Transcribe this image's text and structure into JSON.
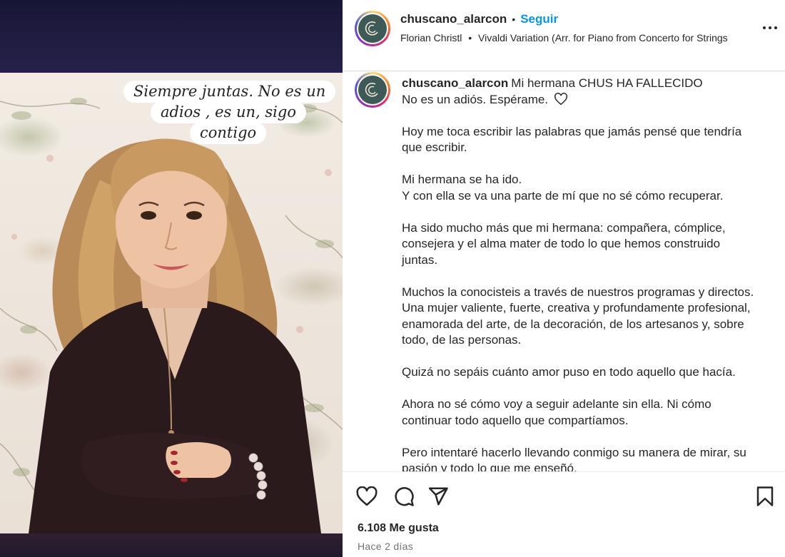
{
  "post": {
    "username": "chuscano_alarcon",
    "follow_label": "Seguir",
    "separator": "•",
    "audio": {
      "artist": "Florian Christl",
      "separator": "•",
      "track": "Vivaldi Variation (Arr. for Piano from Concerto for Strings"
    },
    "media": {
      "overlay_lines": [
        "Siempre juntas. No es un",
        "adios , es un, sigo",
        "contigo"
      ]
    },
    "caption": {
      "username": "chuscano_alarcon",
      "paragraphs": [
        [
          "Mi hermana CHUS HA FALLECIDO",
          "No es un adiós. Espérame."
        ],
        [
          "Hoy me toca escribir las palabras que jamás pensé que tendría",
          "que escribir."
        ],
        [
          "Mi hermana se ha ido.",
          "Y con ella se va una parte de mí que no sé cómo recuperar."
        ],
        [
          "Ha sido mucho más que mi hermana: compañera, cómplice,",
          "consejera y el alma mater de todo lo que hemos construido",
          "juntas."
        ],
        [
          "Muchos la conocisteis a través de nuestros programas y directos.",
          "Una mujer valiente, fuerte, creativa y profundamente profesional,",
          "enamorada del arte, de la decoración, de los artesanos y, sobre",
          "todo, de las personas."
        ],
        [
          "Quizá no sepáis cuánto amor puso en todo aquello que hacía."
        ],
        [
          "Ahora no sé cómo voy a seguir adelante sin ella. Ni cómo",
          "continuar todo aquello que compartíamos."
        ],
        [
          "Pero intentaré hacerlo llevando conmigo su manera de mirar, su",
          "pasión y todo lo que me enseñó."
        ]
      ]
    },
    "likes_label": "6.108 Me gusta",
    "time_label": "Hace 2 días"
  },
  "icons": {
    "like": "heart-icon",
    "comment": "comment-icon",
    "share": "share-icon",
    "save": "bookmark-icon",
    "more": "more-icon",
    "caption_heart": "heart-outline-icon"
  },
  "colors": {
    "accent": "#0095f6",
    "text": "#262626",
    "muted": "#737373",
    "border": "#dbdbdb"
  }
}
